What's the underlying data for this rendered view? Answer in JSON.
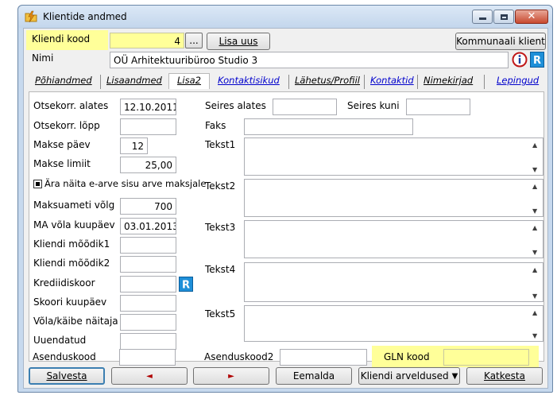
{
  "window": {
    "title": "Klientide andmed",
    "close_glyph": "✕"
  },
  "header": {
    "client_code_label": "Kliendi kood",
    "client_code_value": "4",
    "browse_button": "...",
    "add_new_button": "Lisa uus",
    "utility_client_button": "Kommunaali klient",
    "name_label": "Nimi",
    "name_value": "OÜ Arhitektuuribüroo  Studio 3"
  },
  "tabs": [
    {
      "label": "Põhiandmed",
      "active": false
    },
    {
      "label": "Lisaandmed",
      "active": false
    },
    {
      "label": "Lisa2",
      "active": true
    },
    {
      "label": "Kontaktisikud",
      "active": false
    },
    {
      "label": "Lähetus/Profiil",
      "active": false
    },
    {
      "label": "Kontaktid",
      "active": false
    },
    {
      "label": "Nimekirjad",
      "active": false
    },
    {
      "label": "Lepingud",
      "active": false
    }
  ],
  "left_fields": {
    "otsekorr_alates": {
      "label": "Otsekorr. alates",
      "value": "12.10.2011"
    },
    "otsekorr_lopp": {
      "label": "Otsekorr. lõpp",
      "value": ""
    },
    "makse_paev": {
      "label": "Makse päev",
      "value": "12"
    },
    "makse_limiit": {
      "label": "Makse limiit",
      "value": "25,00"
    },
    "hide_einvoice": {
      "label": "Ära näita e-arve sisu arve maksjale",
      "checked": true
    },
    "maksuameti_volg": {
      "label": "Maksuameti võlg",
      "value": "700"
    },
    "ma_volg_kuupaev": {
      "label": "MA võla kuupäev",
      "value": "03.01.2013"
    },
    "kliendi_moodik1": {
      "label": "Kliendi mõõdik1",
      "value": ""
    },
    "kliendi_moodik2": {
      "label": "Kliendi mõõdik2",
      "value": ""
    },
    "krediidiskoor": {
      "label": "Krediidiskoor",
      "value": ""
    },
    "skoori_kuupaev": {
      "label": "Skoori kuupäev",
      "value": ""
    },
    "vola_kaibe": {
      "label": "Võla/käibe näitaja",
      "value": ""
    },
    "uuendatud": {
      "label": "Uuendatud",
      "value": ""
    },
    "asenduskood": {
      "label": "Asenduskood",
      "value": ""
    }
  },
  "right_fields": {
    "seires_alates": {
      "label": "Seires alates",
      "value": ""
    },
    "seires_kuni": {
      "label": "Seires kuni",
      "value": ""
    },
    "faks": {
      "label": "Faks",
      "value": ""
    },
    "tekst1": {
      "label": "Tekst1",
      "value": ""
    },
    "tekst2": {
      "label": "Tekst2",
      "value": ""
    },
    "tekst3": {
      "label": "Tekst3",
      "value": ""
    },
    "tekst4": {
      "label": "Tekst4",
      "value": ""
    },
    "tekst5": {
      "label": "Tekst5",
      "value": ""
    },
    "asenduskood2": {
      "label": "Asenduskood2",
      "value": ""
    },
    "gln_kood": {
      "label": "GLN kood",
      "value": ""
    }
  },
  "bottom": {
    "save": "Salvesta",
    "prev_glyph": "◄",
    "next_glyph": "►",
    "remove": "Eemalda",
    "client_invoices": "Kliendi arveldused",
    "invoices_arrow": "▼",
    "cancel": "Katkesta"
  },
  "icons": {
    "app": "folder-lightning-icon",
    "info": "info-icon",
    "r_lookup": "r-lookup-icon"
  },
  "colors": {
    "highlight": "#ffff99",
    "tab_link": "#0000cc",
    "window_frame": "#c7d9ee"
  }
}
